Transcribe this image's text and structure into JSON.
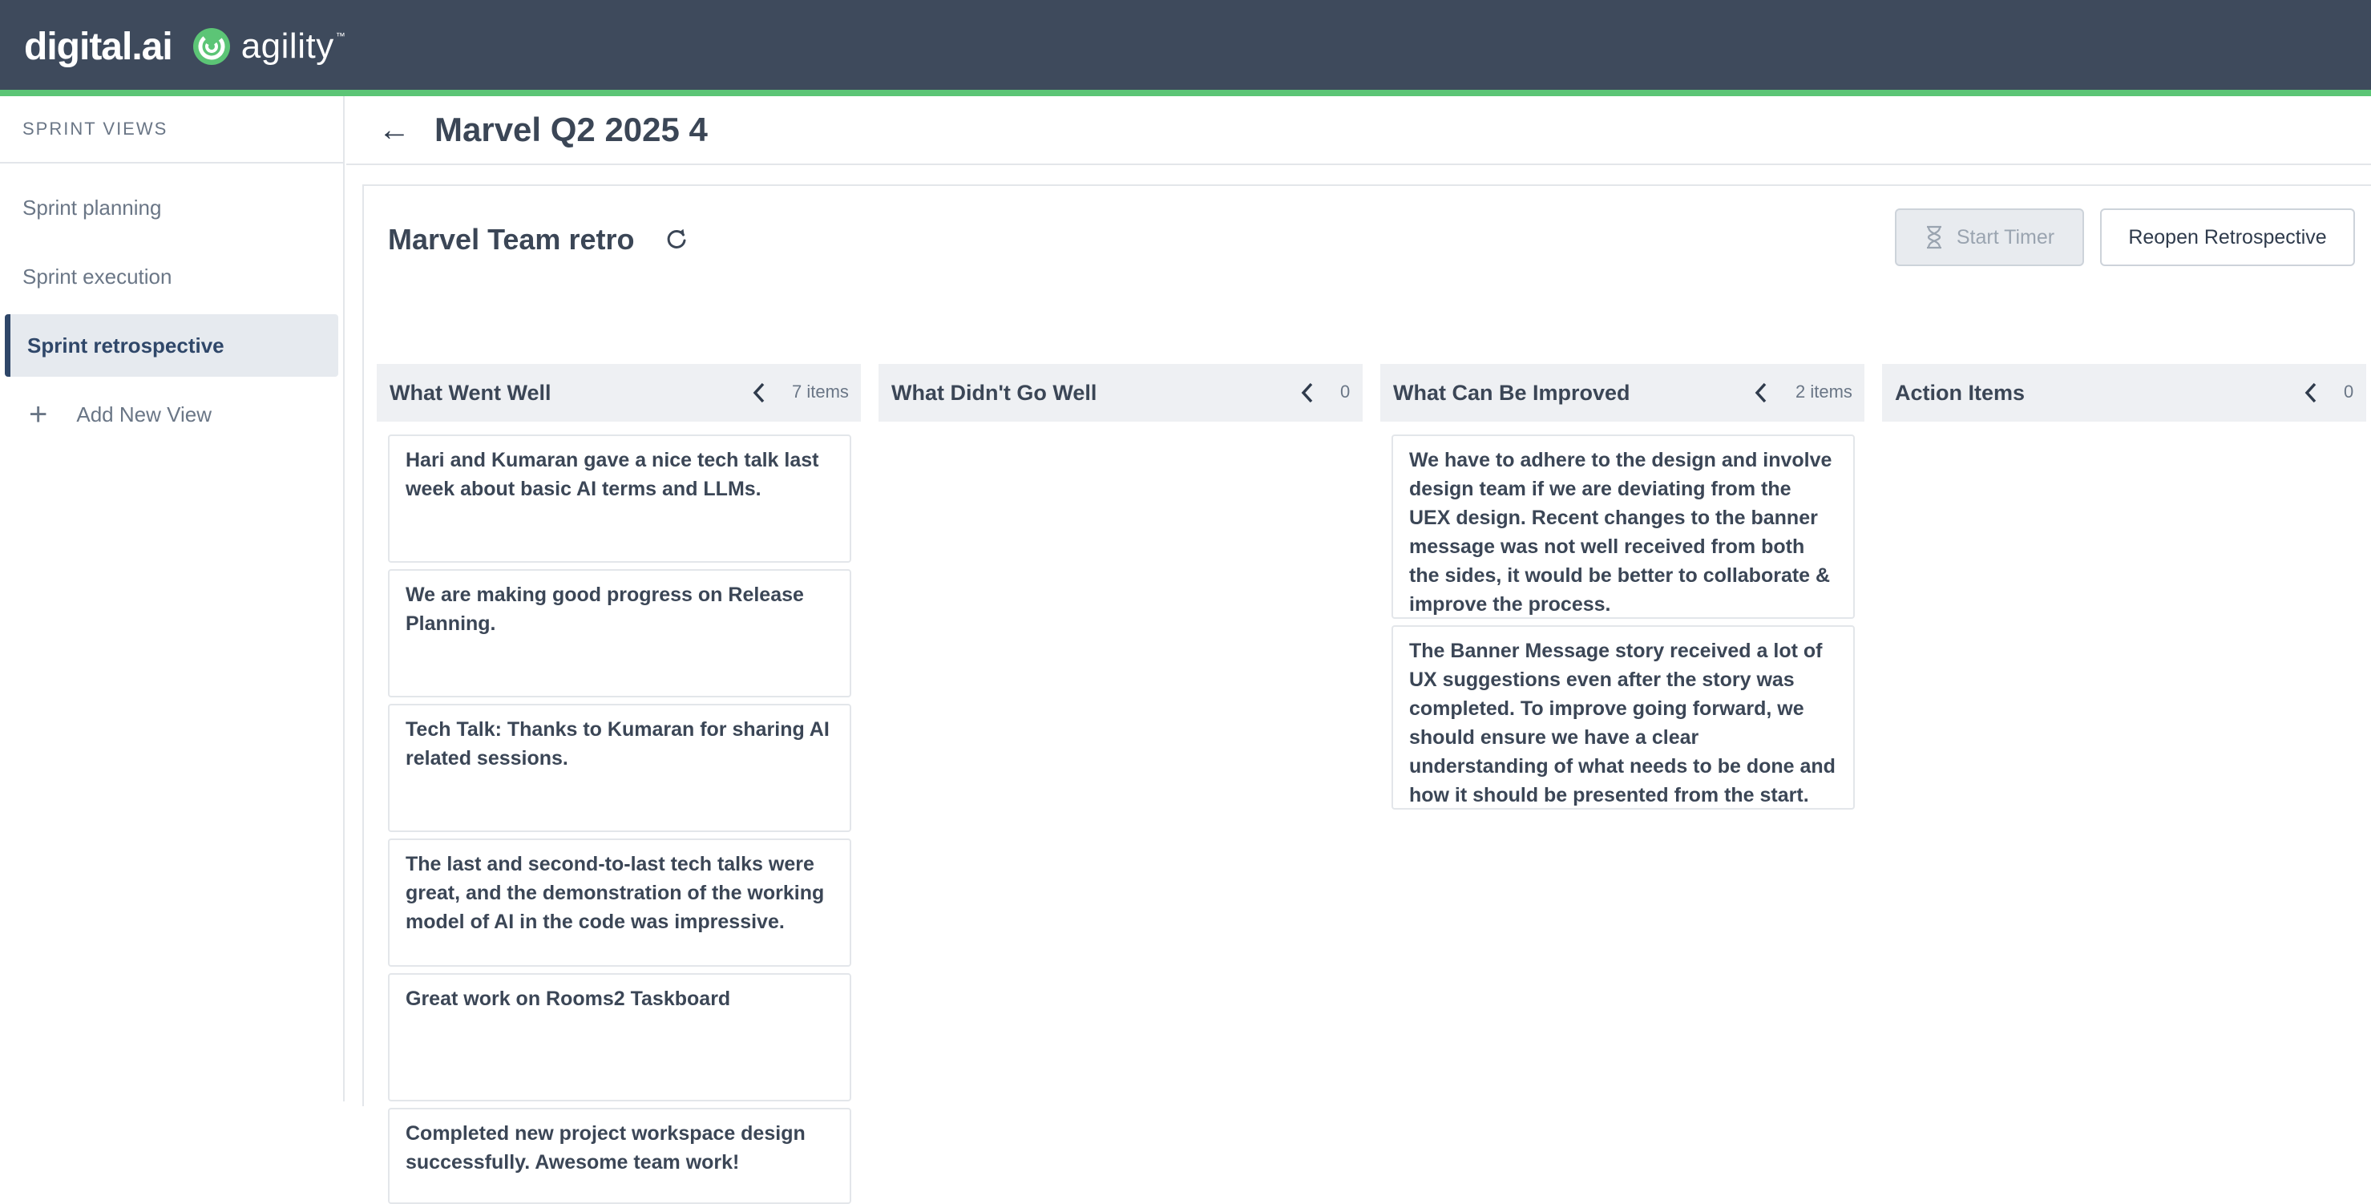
{
  "brand": {
    "digital": "digital.ai",
    "agility": "agility",
    "tm": "™"
  },
  "sidebar": {
    "heading": "SPRINT VIEWS",
    "items": [
      {
        "label": "Sprint planning"
      },
      {
        "label": "Sprint execution"
      },
      {
        "label": "Sprint retrospective"
      }
    ],
    "add_label": "Add New View"
  },
  "page": {
    "title": "Marvel Q2 2025 4"
  },
  "retro": {
    "title": "Marvel Team retro",
    "start_timer_label": "Start Timer",
    "reopen_label": "Reopen Retrospective"
  },
  "columns": [
    {
      "title": "What Went Well",
      "count": "7 items",
      "cards": [
        "Hari and Kumaran gave a nice tech talk last week about basic AI terms and LLMs.",
        "We are making good progress on Release Planning.",
        "Tech Talk: Thanks to Kumaran for sharing AI related sessions.",
        "The last and second-to-last tech talks were great, and the demonstration of the working model of AI in the code was impressive.",
        "Great work on Rooms2 Taskboard",
        "Completed new project workspace design successfully. Awesome team work!"
      ]
    },
    {
      "title": "What Didn't Go Well",
      "count": "0",
      "cards": []
    },
    {
      "title": "What Can Be Improved",
      "count": "2 items",
      "cards": [
        "We have to adhere to the design and involve design team if we are deviating from the UEX design. Recent changes to the banner message was not well received from both the sides, it would be better to collaborate & improve the process.",
        "The Banner Message story received a lot of UX suggestions even after the story was completed. To improve going forward, we should ensure we have a clear understanding of what needs to be done and how it should be presented from the start."
      ]
    },
    {
      "title": "Action Items",
      "count": "0",
      "cards": []
    }
  ],
  "colors": {
    "topbar": "#3e4a5c",
    "accent_green": "#5cc576",
    "active_nav": "#2f4769"
  }
}
